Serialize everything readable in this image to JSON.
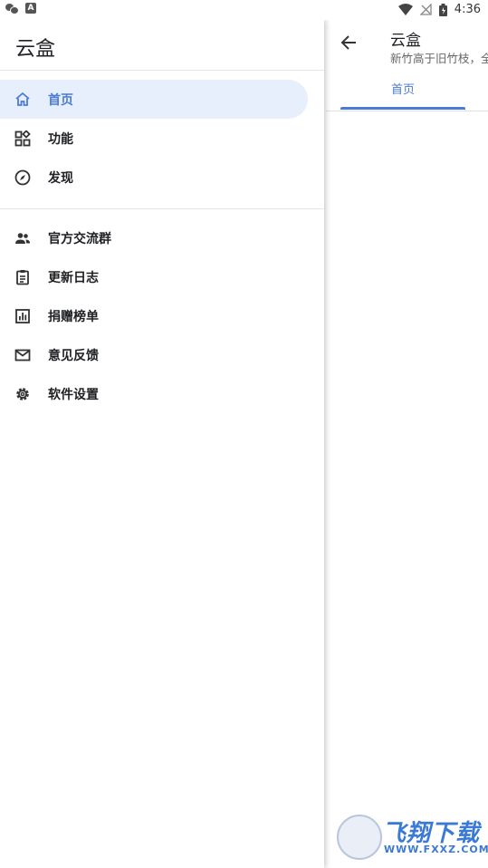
{
  "status_bar": {
    "time": "4:36",
    "left_badge": "A"
  },
  "app": {
    "title": "云盒",
    "subtitle": "新竹高于旧竹枝，全",
    "tabs": [
      {
        "label": "首页"
      }
    ]
  },
  "drawer": {
    "title": "云盒",
    "primary_items": [
      {
        "label": "首页",
        "icon": "home-icon",
        "active": true
      },
      {
        "label": "功能",
        "icon": "widgets-icon"
      },
      {
        "label": "发现",
        "icon": "compass-icon"
      }
    ],
    "secondary_items": [
      {
        "label": "官方交流群",
        "icon": "group-icon"
      },
      {
        "label": "更新日志",
        "icon": "clipboard-icon"
      },
      {
        "label": "捐赠榜单",
        "icon": "bar-chart-icon"
      },
      {
        "label": "意见反馈",
        "icon": "mail-icon"
      },
      {
        "label": "软件设置",
        "icon": "gear-icon"
      }
    ]
  },
  "watermark": {
    "text": "飞翔下载",
    "url": "WWW.FXXZ.COM"
  },
  "colors": {
    "accent": "#4a7bd6",
    "active_bg": "#e8effc",
    "text": "#202124"
  }
}
